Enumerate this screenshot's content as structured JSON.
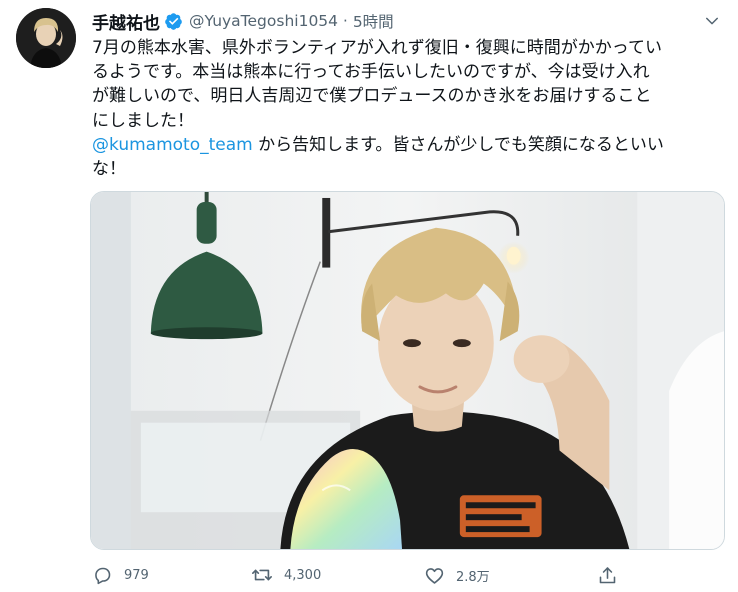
{
  "tweet": {
    "display_name": "手越祐也",
    "handle": "@YuyaTegoshi1054",
    "separator": "·",
    "time": "5時間",
    "text_lines": [
      "7月の熊本水害、県外ボランティアが入れず復旧・復興に時間がかかってい",
      "るようです。本当は熊本に行ってお手伝いしたいのですが、今は受け入れ",
      "が難しいので、明日人吉周辺で僕プロデュースのかき氷をお届けすること",
      "にしました！"
    ],
    "mention": "@kumamoto_team",
    "after_mention": " から告知します。皆さんが少しでも笑顔になるといい",
    "last_line": "な！"
  },
  "stats": {
    "replies": "979",
    "retweets": "4,300",
    "likes": "2.8万"
  },
  "colors": {
    "link": "#1b95e0",
    "verified": "#1d9bf0",
    "muted": "#536471"
  },
  "icons": {
    "verified": "verified-badge-icon",
    "caret": "chevron-down-icon",
    "reply": "reply-icon",
    "retweet": "retweet-icon",
    "like": "heart-icon",
    "share": "share-icon"
  }
}
